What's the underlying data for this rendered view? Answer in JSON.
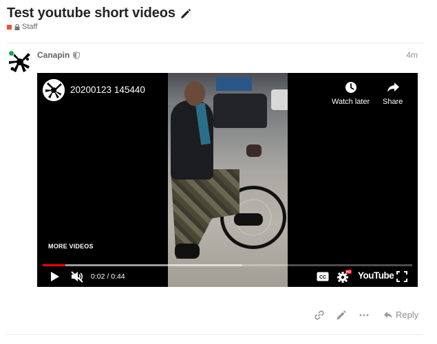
{
  "topic": {
    "title": "Test youtube short videos",
    "category": "Staff",
    "category_color": "#e45735"
  },
  "post": {
    "author": "Canapin",
    "time": "4m",
    "online_color": "#1ca551"
  },
  "video": {
    "title": "20200123 145440",
    "watch_later_label": "Watch later",
    "share_label": "Share",
    "more_videos_label": "MORE VIDEOS",
    "time_display": "0:02 / 0:44",
    "played_fraction": 0.062,
    "buffered_fraction": 0.54,
    "cc_label": "CC",
    "hd_badge": "HD",
    "wordmark": "YouTube",
    "accent_color": "#ff0000"
  },
  "post_actions": {
    "reply_label": "Reply",
    "icons": [
      "link-icon",
      "pencil-icon",
      "ellipsis-icon",
      "reply-icon"
    ]
  }
}
